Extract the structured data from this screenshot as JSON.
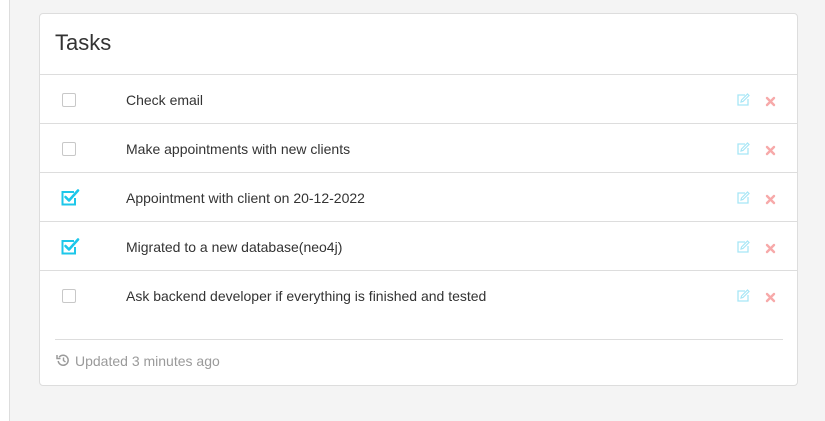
{
  "card": {
    "title": "Tasks",
    "footer_text": "Updated 3 minutes ago"
  },
  "tasks": [
    {
      "label": "Check email",
      "checked": false
    },
    {
      "label": "Make appointments with new clients",
      "checked": false
    },
    {
      "label": "Appointment with client on 20-12-2022",
      "checked": true
    },
    {
      "label": "Migrated to a new database(neo4j)",
      "checked": true
    },
    {
      "label": "Ask backend developer if everything is finished and tested",
      "checked": false
    }
  ],
  "icons": {
    "edit": "edit-icon",
    "delete": "close-icon",
    "checked": "check-icon",
    "footer": "history-icon"
  },
  "colors": {
    "check_accent": "#1dc7ea",
    "edit": "#a7e6f6",
    "delete": "#f7a9a9",
    "muted_text": "#9a9a9a"
  }
}
